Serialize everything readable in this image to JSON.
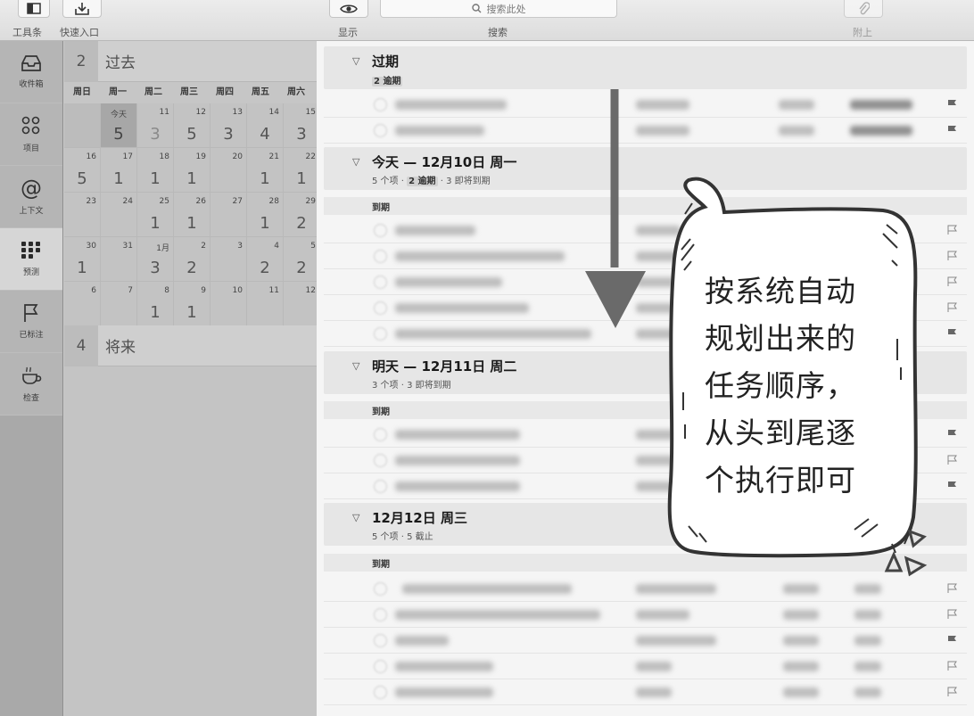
{
  "toolbar": {
    "toolbar_label": "工具条",
    "quick_entry_label": "快速入口",
    "view_label": "显示",
    "search_label": "搜索",
    "search_placeholder": "搜索此处",
    "attach_label": "附上"
  },
  "sidebar": {
    "items": [
      {
        "label": "收件箱",
        "icon": "inbox-icon"
      },
      {
        "label": "项目",
        "icon": "projects-icon"
      },
      {
        "label": "上下文",
        "icon": "at-sign-icon"
      },
      {
        "label": "预测",
        "icon": "forecast-icon",
        "active": true
      },
      {
        "label": "已标注",
        "icon": "flag-icon"
      },
      {
        "label": "检查",
        "icon": "review-cup-icon"
      }
    ]
  },
  "calendar": {
    "past": {
      "count": "2",
      "label": "过去"
    },
    "future": {
      "count": "4",
      "label": "将来"
    },
    "weekdays": [
      "周日",
      "周一",
      "周二",
      "周三",
      "周四",
      "周五",
      "周六"
    ],
    "weeks": [
      [
        {
          "d": "",
          "c": ""
        },
        {
          "d": "今天",
          "c": "5",
          "today": true
        },
        {
          "d": "11",
          "c": "3",
          "dim": true
        },
        {
          "d": "12",
          "c": "5"
        },
        {
          "d": "13",
          "c": "3"
        },
        {
          "d": "14",
          "c": "4"
        },
        {
          "d": "15",
          "c": "3"
        }
      ],
      [
        {
          "d": "16",
          "c": "5"
        },
        {
          "d": "17",
          "c": "1"
        },
        {
          "d": "18",
          "c": "1"
        },
        {
          "d": "19",
          "c": "1"
        },
        {
          "d": "20",
          "c": ""
        },
        {
          "d": "21",
          "c": "1"
        },
        {
          "d": "22",
          "c": "1"
        }
      ],
      [
        {
          "d": "23",
          "c": ""
        },
        {
          "d": "24",
          "c": ""
        },
        {
          "d": "25",
          "c": "1"
        },
        {
          "d": "26",
          "c": "1"
        },
        {
          "d": "27",
          "c": ""
        },
        {
          "d": "28",
          "c": "1"
        },
        {
          "d": "29",
          "c": "2"
        }
      ],
      [
        {
          "d": "30",
          "c": "1"
        },
        {
          "d": "31",
          "c": ""
        },
        {
          "d": "1月",
          "c": "3"
        },
        {
          "d": "2",
          "c": "2"
        },
        {
          "d": "3",
          "c": ""
        },
        {
          "d": "4",
          "c": "2"
        },
        {
          "d": "5",
          "c": "2"
        }
      ],
      [
        {
          "d": "6",
          "c": ""
        },
        {
          "d": "7",
          "c": ""
        },
        {
          "d": "8",
          "c": "1"
        },
        {
          "d": "9",
          "c": "1"
        },
        {
          "d": "10",
          "c": ""
        },
        {
          "d": "11",
          "c": ""
        },
        {
          "d": "12",
          "c": ""
        }
      ]
    ]
  },
  "list": {
    "overdue": {
      "title": "过期",
      "badge": "2 逾期"
    },
    "today": {
      "title": "今天 — 12月10日 周一",
      "count": "5 个项",
      "badge": "2 逾期",
      "soon": "3 即将到期",
      "due_label": "到期"
    },
    "tomorrow": {
      "title": "明天 — 12月11日 周二",
      "count": "3 个项",
      "soon": "3 即将到期",
      "due_label": "到期"
    },
    "wed": {
      "title": "12月12日 周三",
      "count": "5 个项",
      "soon": "5 截止",
      "due_label": "到期"
    }
  },
  "annotation": {
    "lines": [
      "按系统自动",
      "规划出来的",
      "任务顺序，",
      "从头到尾逐",
      "个执行即可"
    ]
  }
}
